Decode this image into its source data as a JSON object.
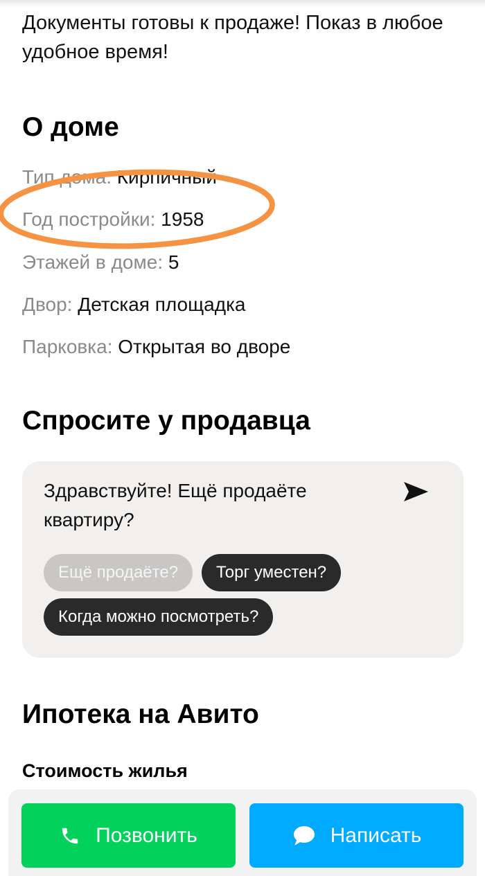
{
  "description": "Документы готовы к продаже! Показ в любое удобное время!",
  "about": {
    "title": "О доме",
    "props": [
      {
        "key": "Тип дома:",
        "value": "Кирпичный"
      },
      {
        "key": "Год постройки:",
        "value": "1958"
      },
      {
        "key": "Этажей в доме:",
        "value": "5"
      },
      {
        "key": "Двор:",
        "value": "Детская площадка"
      },
      {
        "key": "Парковка:",
        "value": "Открытая во дворе"
      }
    ]
  },
  "ask": {
    "title": "Спросите у продавца",
    "message": "Здравствуйте! Ещё продаёте квартиру?",
    "send_icon": "send-arrow-icon",
    "chips": [
      "Ещё продаёте?",
      "Торг уместен?",
      "Когда можно посмотреть?"
    ]
  },
  "mortgage": {
    "title": "Ипотека на Авито",
    "subtitle": "Стоимость жилья"
  },
  "actions": {
    "call_label": "Позвонить",
    "call_icon": "phone-icon",
    "write_label": "Написать",
    "write_icon": "chat-bubble-icon"
  },
  "colors": {
    "call_green": "#02d15c",
    "write_blue": "#00aaff",
    "highlight_orange": "#f59342"
  }
}
